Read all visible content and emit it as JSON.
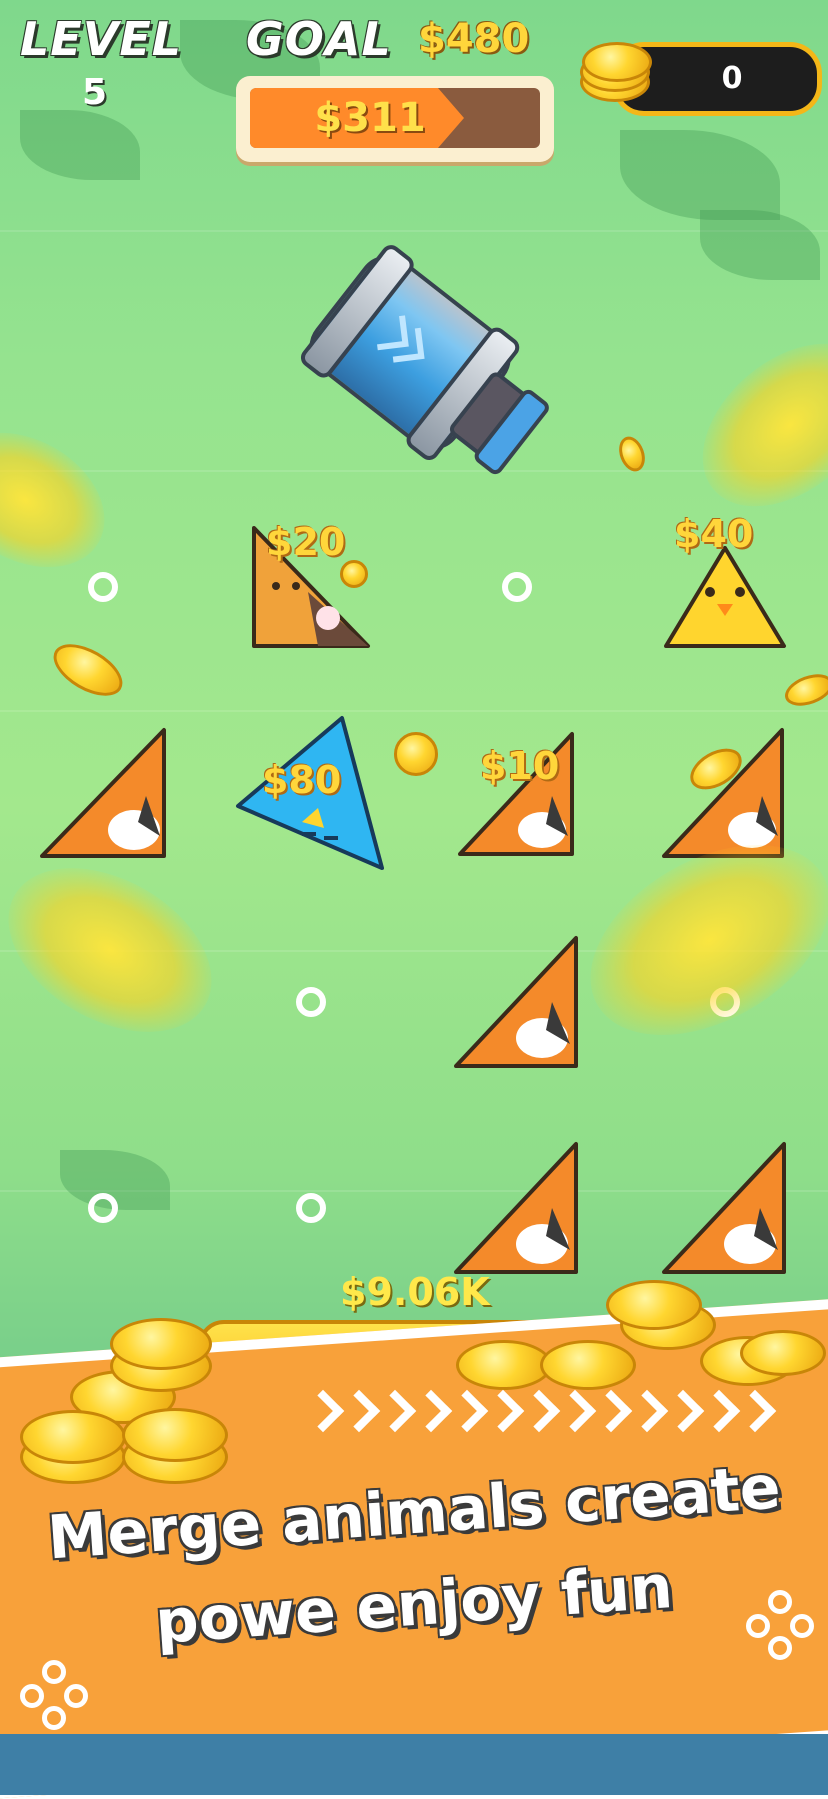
{
  "hud": {
    "level_label": "LEVEL",
    "level_value": "5",
    "goal_label": "GOAL",
    "goal_amount": "$480",
    "progress_text": "$311",
    "progress_fraction": 0.648,
    "coin_count": "0"
  },
  "board": {
    "prices": {
      "chick_top": "$20",
      "chick_right": "$40",
      "bird": "$80",
      "fox_mid": "$10"
    }
  },
  "bank": {
    "amount": "$9.06K"
  },
  "banner": {
    "line1": "Merge animals create",
    "line2": "powe enjoy fun"
  },
  "icons": [
    "cannon-icon",
    "coin-icon",
    "triangle-icon",
    "square-icon",
    "circle-icon"
  ]
}
